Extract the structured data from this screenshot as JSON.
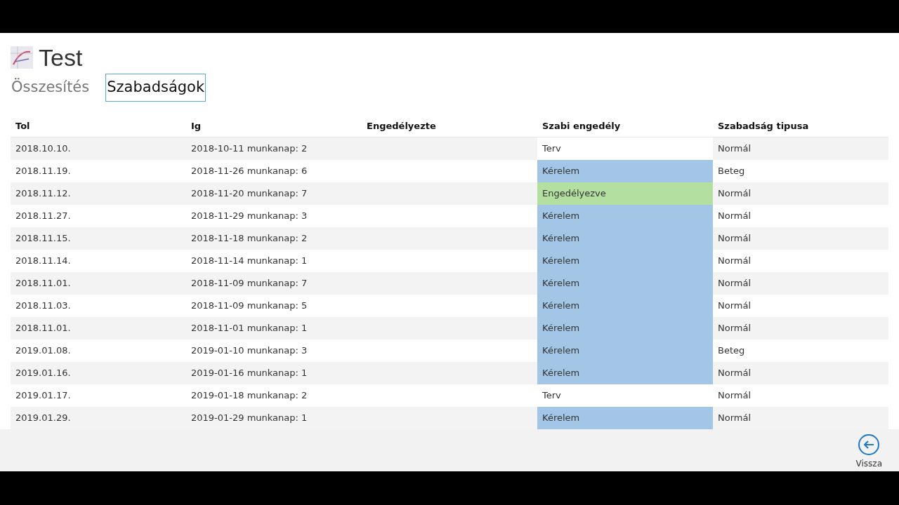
{
  "app": {
    "title": "Test"
  },
  "tabs": [
    {
      "label": "Összesítés",
      "selected": false
    },
    {
      "label": "Szabadságok",
      "selected": true
    }
  ],
  "table": {
    "columns": [
      "Tol",
      "Ig",
      "Engedélyezte",
      "Szabi engedély",
      "Szabadság tipusa"
    ],
    "rows": [
      {
        "tol": "2018.10.10.",
        "ig": "2018-10-11 munkanap: 2",
        "status": "Terv",
        "kind": "plan",
        "type": "Normál"
      },
      {
        "tol": "2018.11.19.",
        "ig": "2018-11-26 munkanap: 6",
        "status": "Kérelem",
        "kind": "request",
        "type": "Beteg"
      },
      {
        "tol": "2018.11.12.",
        "ig": "2018-11-20 munkanap: 7",
        "status": "Engedélyezve",
        "kind": "approved",
        "type": "Normál"
      },
      {
        "tol": "2018.11.27.",
        "ig": "2018-11-29 munkanap: 3",
        "status": "Kérelem",
        "kind": "request",
        "type": "Normál"
      },
      {
        "tol": "2018.11.15.",
        "ig": "2018-11-18 munkanap: 2",
        "status": "Kérelem",
        "kind": "request",
        "type": "Normál"
      },
      {
        "tol": "2018.11.14.",
        "ig": "2018-11-14 munkanap: 1",
        "status": "Kérelem",
        "kind": "request",
        "type": "Normál"
      },
      {
        "tol": "2018.11.01.",
        "ig": "2018-11-09 munkanap: 7",
        "status": "Kérelem",
        "kind": "request",
        "type": "Normál"
      },
      {
        "tol": "2018.11.03.",
        "ig": "2018-11-09 munkanap: 5",
        "status": "Kérelem",
        "kind": "request",
        "type": "Normál"
      },
      {
        "tol": "2018.11.01.",
        "ig": "2018-11-01 munkanap: 1",
        "status": "Kérelem",
        "kind": "request",
        "type": "Normál"
      },
      {
        "tol": "2019.01.08.",
        "ig": "2019-01-10 munkanap: 3",
        "status": "Kérelem",
        "kind": "request",
        "type": "Beteg"
      },
      {
        "tol": "2019.01.16.",
        "ig": "2019-01-16 munkanap: 1",
        "status": "Kérelem",
        "kind": "request",
        "type": "Normál"
      },
      {
        "tol": "2019.01.17.",
        "ig": "2019-01-18 munkanap: 2",
        "status": "Terv",
        "kind": "plan",
        "type": "Normál"
      },
      {
        "tol": "2019.01.29.",
        "ig": "2019-01-29 munkanap: 1",
        "status": "Kérelem",
        "kind": "request",
        "type": "Normál"
      }
    ]
  },
  "back_button": {
    "label": "Vissza"
  }
}
